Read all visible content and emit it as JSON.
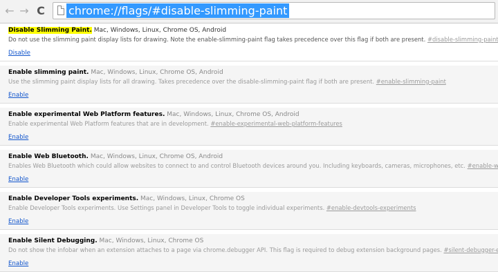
{
  "omnibox": {
    "url": "chrome://flags/#disable-slimming-paint"
  },
  "icons": {
    "back": "←",
    "forward": "→",
    "reload": "C",
    "page": "page-icon"
  },
  "colors": {
    "highlight": "#ffff00",
    "selection": "#3399ff",
    "link": "#1155cc"
  },
  "experiments": [
    {
      "name": "Disable Slimming Paint.",
      "platforms": "Mac, Windows, Linux, Chrome OS, Android",
      "description": "Do not use the slimming paint display lists for drawing. Note the enable-slimming-paint flag takes precedence over this flag if both are present.",
      "anchor": "#disable-slimming-paint",
      "action": "Disable"
    },
    {
      "name": "Enable slimming paint.",
      "platforms": "Mac, Windows, Linux, Chrome OS, Android",
      "description": "Use the slimming paint display lists for all drawing. Takes precedence over the disable-slimming-paint flag if both are present.",
      "anchor": "#enable-slimming-paint",
      "action": "Enable"
    },
    {
      "name": "Enable experimental Web Platform features.",
      "platforms": "Mac, Windows, Linux, Chrome OS, Android",
      "description": "Enable experimental Web Platform features that are in development.",
      "anchor": "#enable-experimental-web-platform-features",
      "action": "Enable"
    },
    {
      "name": "Enable Web Bluetooth.",
      "platforms": "Mac, Windows, Linux, Chrome OS, Android",
      "description": "Enables Web Bluetooth which could allow websites to connect to and control Bluetooth devices around you. Including keyboards, cameras, microphones, etc.",
      "anchor": "#enable-web-bluetooth",
      "action": "Enable"
    },
    {
      "name": "Enable Developer Tools experiments.",
      "platforms": "Mac, Windows, Linux, Chrome OS",
      "description": "Enable Developer Tools experiments. Use Settings panel in Developer Tools to toggle individual experiments.",
      "anchor": "#enable-devtools-experiments",
      "action": "Enable"
    },
    {
      "name": "Enable Silent Debugging.",
      "platforms": "Mac, Windows, Linux, Chrome OS",
      "description": "Do not show the infobar when an extension attaches to a page via chrome.debugger API. This flag is required to debug extension background pages.",
      "anchor": "#silent-debugger-extension-api",
      "action": "Enable"
    }
  ]
}
